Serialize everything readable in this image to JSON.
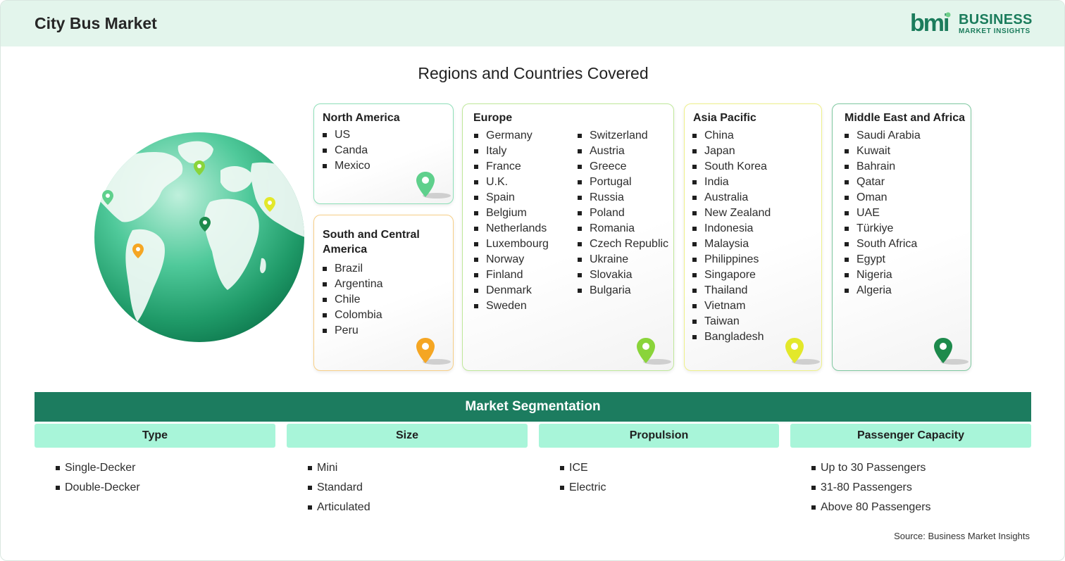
{
  "header": {
    "title": "City Bus Market",
    "logo_line1": "BUSINESS",
    "logo_line2": "MARKET INSIGHTS",
    "logo_mark": "bmi"
  },
  "regions_title": "Regions and Countries Covered",
  "regions": {
    "north_america": {
      "title": "North America",
      "countries": [
        "US",
        "Canda",
        "Mexico"
      ],
      "color": "#5fd08c"
    },
    "south_america": {
      "title": "South and Central America",
      "countries": [
        "Brazil",
        "Argentina",
        "Chile",
        "Colombia",
        "Peru"
      ],
      "color": "#f5a623"
    },
    "europe": {
      "title": "Europe",
      "countries_col1": [
        "Germany",
        "Italy",
        "France",
        "U.K.",
        "Spain",
        "Belgium",
        "Netherlands",
        "Luxembourg",
        "Norway",
        "Finland",
        "Denmark",
        "Sweden"
      ],
      "countries_col2": [
        "Switzerland",
        "Austria",
        "Greece",
        "Portugal",
        "Russia",
        "Poland",
        "Romania",
        "Czech Republic",
        "Ukraine",
        "Slovakia",
        "Bulgaria"
      ],
      "color": "#8ad43a"
    },
    "asia_pacific": {
      "title": "Asia Pacific",
      "countries": [
        "China",
        "Japan",
        "South Korea",
        "India",
        "Australia",
        "New Zealand",
        "Indonesia",
        "Malaysia",
        "Philippines",
        "Singapore",
        "Thailand",
        "Vietnam",
        "Taiwan",
        "Bangladesh"
      ],
      "color": "#e3e82a"
    },
    "mea": {
      "title": "Middle East and Africa",
      "countries": [
        "Saudi Arabia",
        "Kuwait",
        "Bahrain",
        "Qatar",
        "Oman",
        "UAE",
        "Türkiye",
        "South Africa",
        "Egypt",
        "Nigeria",
        "Algeria"
      ],
      "color": "#1d8a4c"
    }
  },
  "segmentation": {
    "title": "Market Segmentation",
    "columns": [
      {
        "header": "Type",
        "items": [
          "Single-Decker",
          "Double-Decker"
        ]
      },
      {
        "header": "Size",
        "items": [
          "Mini",
          "Standard",
          "Articulated"
        ]
      },
      {
        "header": "Propulsion",
        "items": [
          "ICE",
          "Electric"
        ]
      },
      {
        "header": "Passenger Capacity",
        "items": [
          "Up to 30 Passengers",
          "31-80 Passengers",
          "Above 80 Passengers"
        ]
      }
    ]
  },
  "source": "Source: Business Market Insights",
  "icons": {
    "globe": "globe-icon",
    "pin": "map-pin-icon"
  }
}
